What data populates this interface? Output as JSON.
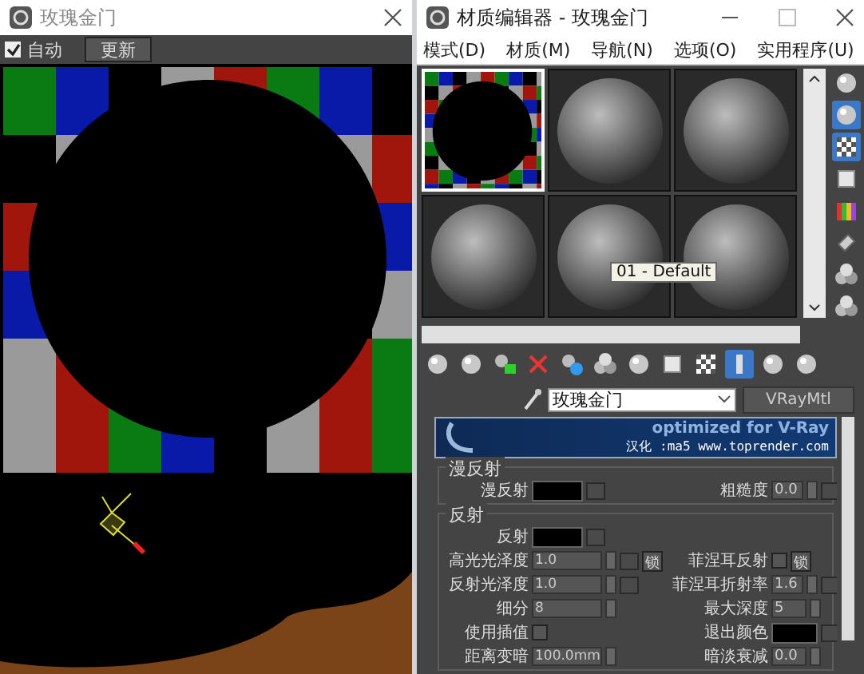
{
  "render_window": {
    "title": "玫瑰金门",
    "auto_checkbox": {
      "label": "自动",
      "checked": true
    },
    "update_button": "更新"
  },
  "material_editor": {
    "title": "材质编辑器 - 玫瑰金门",
    "menu": [
      "模式(D)",
      "材质(M)",
      "导航(N)",
      "选项(O)",
      "实用程序(U)"
    ],
    "slots": [
      {
        "kind": "checker",
        "selected": true
      },
      {
        "kind": "sphere",
        "selected": false
      },
      {
        "kind": "sphere",
        "selected": false
      },
      {
        "kind": "sphere",
        "selected": false
      },
      {
        "kind": "sphere",
        "selected": false
      },
      {
        "kind": "sphere",
        "selected": false
      }
    ],
    "tooltip": "01 - Default",
    "side_tools": [
      {
        "kind": "sphere",
        "selected": false
      },
      {
        "kind": "sphere",
        "selected": true
      },
      {
        "kind": "checker",
        "selected": true
      },
      {
        "kind": "square",
        "selected": false
      },
      {
        "kind": "bars",
        "selected": false
      },
      {
        "kind": "stripes",
        "selected": false
      },
      {
        "kind": "spheres",
        "selected": false
      },
      {
        "kind": "spheres",
        "selected": false
      }
    ],
    "tools": [
      {
        "kind": "sphere",
        "selected": false
      },
      {
        "kind": "sphere",
        "selected": false
      },
      {
        "kind": "assign",
        "selected": false
      },
      {
        "kind": "delete",
        "selected": false
      },
      {
        "kind": "copy",
        "selected": false
      },
      {
        "kind": "spheres",
        "selected": false
      },
      {
        "kind": "sphere",
        "selected": false
      },
      {
        "kind": "square",
        "selected": false
      },
      {
        "kind": "checker",
        "selected": false
      },
      {
        "kind": "bar",
        "selected": true
      },
      {
        "kind": "sphere",
        "selected": false
      },
      {
        "kind": "sphere",
        "selected": false
      }
    ],
    "material_name": "玫瑰金门",
    "material_type": "VRayMtl",
    "banner": {
      "slogan": "optimized for V-Ray",
      "credit": "汉化 :ma5 www.toprender.com"
    },
    "groups": [
      {
        "title": "漫反射",
        "rows": [
          {
            "left": {
              "kind": "color",
              "label": "漫反射"
            },
            "right": {
              "kind": "spinner",
              "label": "粗糙度",
              "value": "0.0",
              "map": true
            }
          }
        ]
      },
      {
        "title": "反射",
        "rows": [
          {
            "left": {
              "kind": "color",
              "label": "反射"
            }
          },
          {
            "left": {
              "kind": "spinner",
              "label": "高光光泽度",
              "value": "1.0",
              "map": true,
              "lock": "锁"
            },
            "right": {
              "kind": "checkbox",
              "label": "菲涅耳反射",
              "checked": false,
              "lock": "锁"
            }
          },
          {
            "left": {
              "kind": "spinner",
              "label": "反射光泽度",
              "value": "1.0",
              "map": true
            },
            "right": {
              "kind": "spinner",
              "label": "菲涅耳折射率",
              "value": "1.6",
              "map": true
            }
          },
          {
            "left": {
              "kind": "spinner",
              "label": "细分",
              "value": "8"
            },
            "right": {
              "kind": "spinner",
              "label": "最大深度",
              "value": "5"
            }
          },
          {
            "left": {
              "kind": "checkbox",
              "label": "使用插值",
              "checked": false
            },
            "right": {
              "kind": "color",
              "label": "退出颜色"
            }
          },
          {
            "left": {
              "kind": "spinner",
              "label": "距离变暗",
              "value": "100.0mm"
            },
            "right": {
              "kind": "spinner",
              "label": "暗淡衰减",
              "value": "0.0"
            }
          }
        ]
      }
    ]
  }
}
